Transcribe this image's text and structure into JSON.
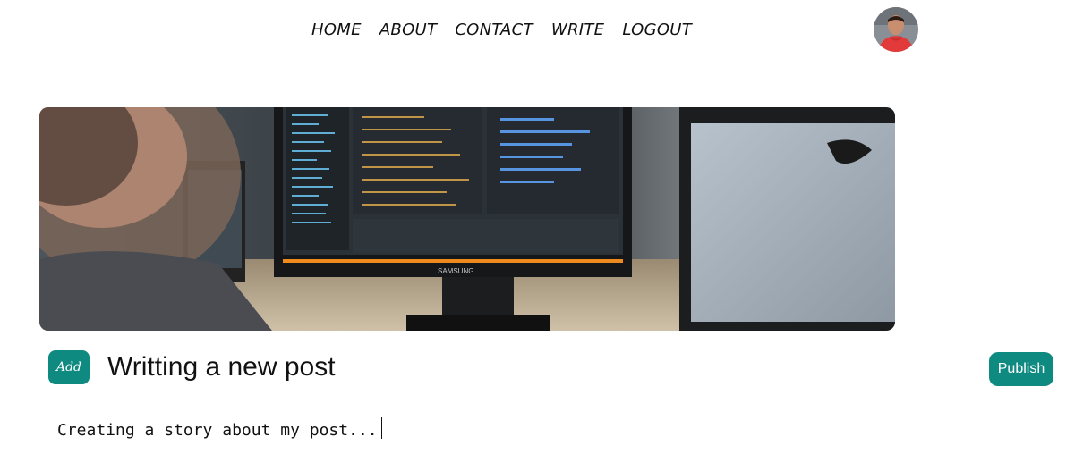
{
  "nav": {
    "items": [
      {
        "label": "HOME"
      },
      {
        "label": "ABOUT"
      },
      {
        "label": "CONTACT"
      },
      {
        "label": "WRITE"
      },
      {
        "label": "LOGOUT"
      }
    ]
  },
  "user": {
    "avatar_icon": "profile-photo"
  },
  "hero": {
    "monitor_brand": "SAMSUNG",
    "image_description_icon": "cover-image"
  },
  "editor": {
    "add_label": "Add",
    "title_placeholder": "Writting a new post",
    "story_value": "Creating a story about my post...",
    "publish_label": "Publish"
  },
  "colors": {
    "accent": "#0e8a80",
    "text": "#111111",
    "background": "#ffffff"
  }
}
